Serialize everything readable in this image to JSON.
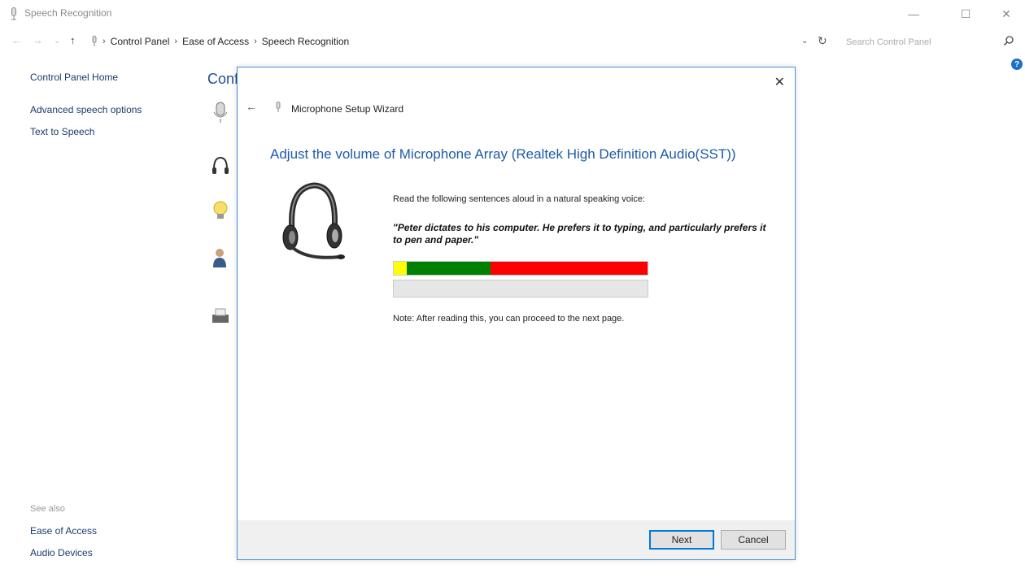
{
  "window": {
    "title": "Speech Recognition",
    "controls": {
      "minimize": "—",
      "maximize": "☐",
      "close": "✕"
    }
  },
  "addressbar": {
    "breadcrumbs": [
      "Control Panel",
      "Ease of Access",
      "Speech Recognition"
    ],
    "separator": "›",
    "search_placeholder": "Search Control Panel"
  },
  "leftnav": {
    "home": "Control Panel Home",
    "links": [
      "Advanced speech options",
      "Text to Speech"
    ],
    "see_also_label": "See also",
    "see_also": [
      "Ease of Access",
      "Audio Devices"
    ]
  },
  "main": {
    "heading_partial": "Conf"
  },
  "help": {
    "label": "?"
  },
  "dialog": {
    "close": "✕",
    "back": "←",
    "title": "Microphone Setup Wizard",
    "heading": "Adjust the volume of Microphone Array (Realtek High Definition Audio(SST))",
    "instruction": "Read the following sentences aloud in a natural speaking voice:",
    "quote": "\"Peter dictates to his computer. He prefers it to typing, and particularly prefers it to pen and paper.\"",
    "meter": {
      "yellow_fraction": 0.05,
      "green_fraction": 0.33,
      "colors": {
        "yellow": "#ffff00",
        "green": "#008000",
        "red": "#ff0000"
      }
    },
    "progress": {
      "fraction": 0.0
    },
    "note": "Note: After reading this, you can proceed to the next page.",
    "buttons": {
      "next": "Next",
      "cancel": "Cancel"
    }
  },
  "colors": {
    "link": "#1a3a6b",
    "heading": "#1e5aa8",
    "accent": "#0078d7"
  }
}
